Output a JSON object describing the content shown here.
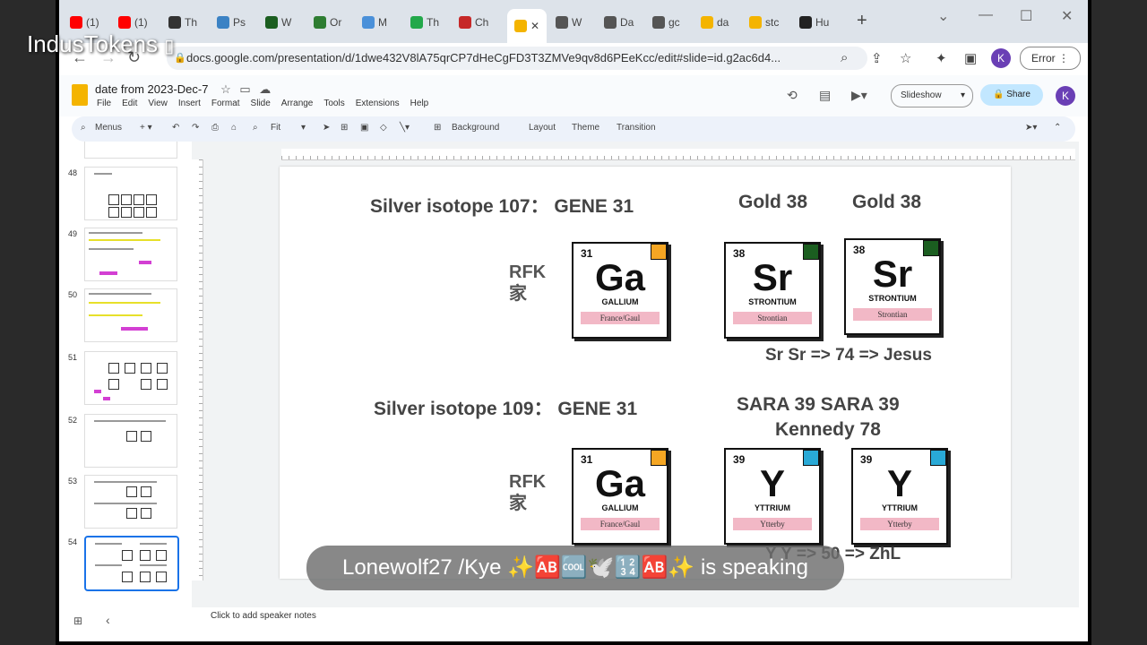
{
  "overlay": {
    "brand": "IndusTokens",
    "speaking": "Lonewolf27 /Kye ✨🆎🆒🕊️🔢🆎✨ is speaking"
  },
  "tabs": [
    {
      "label": "(1)",
      "color": "#ff0000"
    },
    {
      "label": "(1)",
      "color": "#ff0000"
    },
    {
      "label": "Th",
      "color": "#333333"
    },
    {
      "label": "Ps",
      "color": "#3b82c4"
    },
    {
      "label": "W",
      "color": "#1b5e20"
    },
    {
      "label": "Or",
      "color": "#2e7d32"
    },
    {
      "label": "M",
      "color": "#4a90d9"
    },
    {
      "label": "Th",
      "color": "#22a84a"
    },
    {
      "label": "Ch",
      "color": "#c62828"
    },
    {
      "label": "W",
      "color": "#555555"
    },
    {
      "label": "Da",
      "color": "#555555"
    },
    {
      "label": "gc",
      "color": "#555555"
    },
    {
      "label": "da",
      "color": "#f4b400"
    },
    {
      "label": "stc",
      "color": "#f4b400"
    },
    {
      "label": "Hu",
      "color": "#222222"
    }
  ],
  "address": {
    "url": "docs.google.com/presentation/d/1dwe432V8lA75qrCP7dHeCgFD3T3ZMVe9qv8d6PEeKcc/edit#slide=id.g2ac6d4...",
    "error_label": "Error",
    "avatar": "K"
  },
  "app": {
    "title": "date from 2023-Dec-7",
    "menus": [
      "File",
      "Edit",
      "View",
      "Insert",
      "Format",
      "Slide",
      "Arrange",
      "Tools",
      "Extensions",
      "Help"
    ],
    "slideshow": "Slideshow",
    "share": "Share",
    "avatar": "K"
  },
  "toolbar": {
    "menus": "Menus",
    "zoom": "Fit",
    "background": "Background",
    "layout": "Layout",
    "theme": "Theme",
    "transition": "Transition"
  },
  "filmstrip": {
    "numbers": [
      "48",
      "49",
      "50",
      "51",
      "52",
      "53",
      "54"
    ]
  },
  "slide": {
    "row1_left": "Silver isotope 107： GENE 31",
    "row1_gold_a": "Gold 38",
    "row1_gold_b": "Gold 38",
    "rfk1": "RFK",
    "jia1": "家",
    "sr_line": "Sr Sr => 74 => Jesus",
    "row2_left": "Silver isotope 109： GENE 31",
    "sara": "SARA 39 SARA 39",
    "kennedy": "Kennedy 78",
    "rfk2": "RFK",
    "jia2": "家",
    "yy_line": "Y Y => 50 => ZhL",
    "cards": {
      "ga": {
        "num": "31",
        "sym": "Ga",
        "name": "GALLIUM",
        "place": "France/Gaul",
        "corner": "#f5a623"
      },
      "sr": {
        "num": "38",
        "sym": "Sr",
        "name": "STRONTIUM",
        "place": "Strontian",
        "corner": "#1b5e20"
      },
      "y": {
        "num": "39",
        "sym": "Y",
        "name": "YTTRIUM",
        "place": "Ytterby",
        "corner": "#29a9d6"
      }
    }
  },
  "notes": "Click to add speaker notes"
}
